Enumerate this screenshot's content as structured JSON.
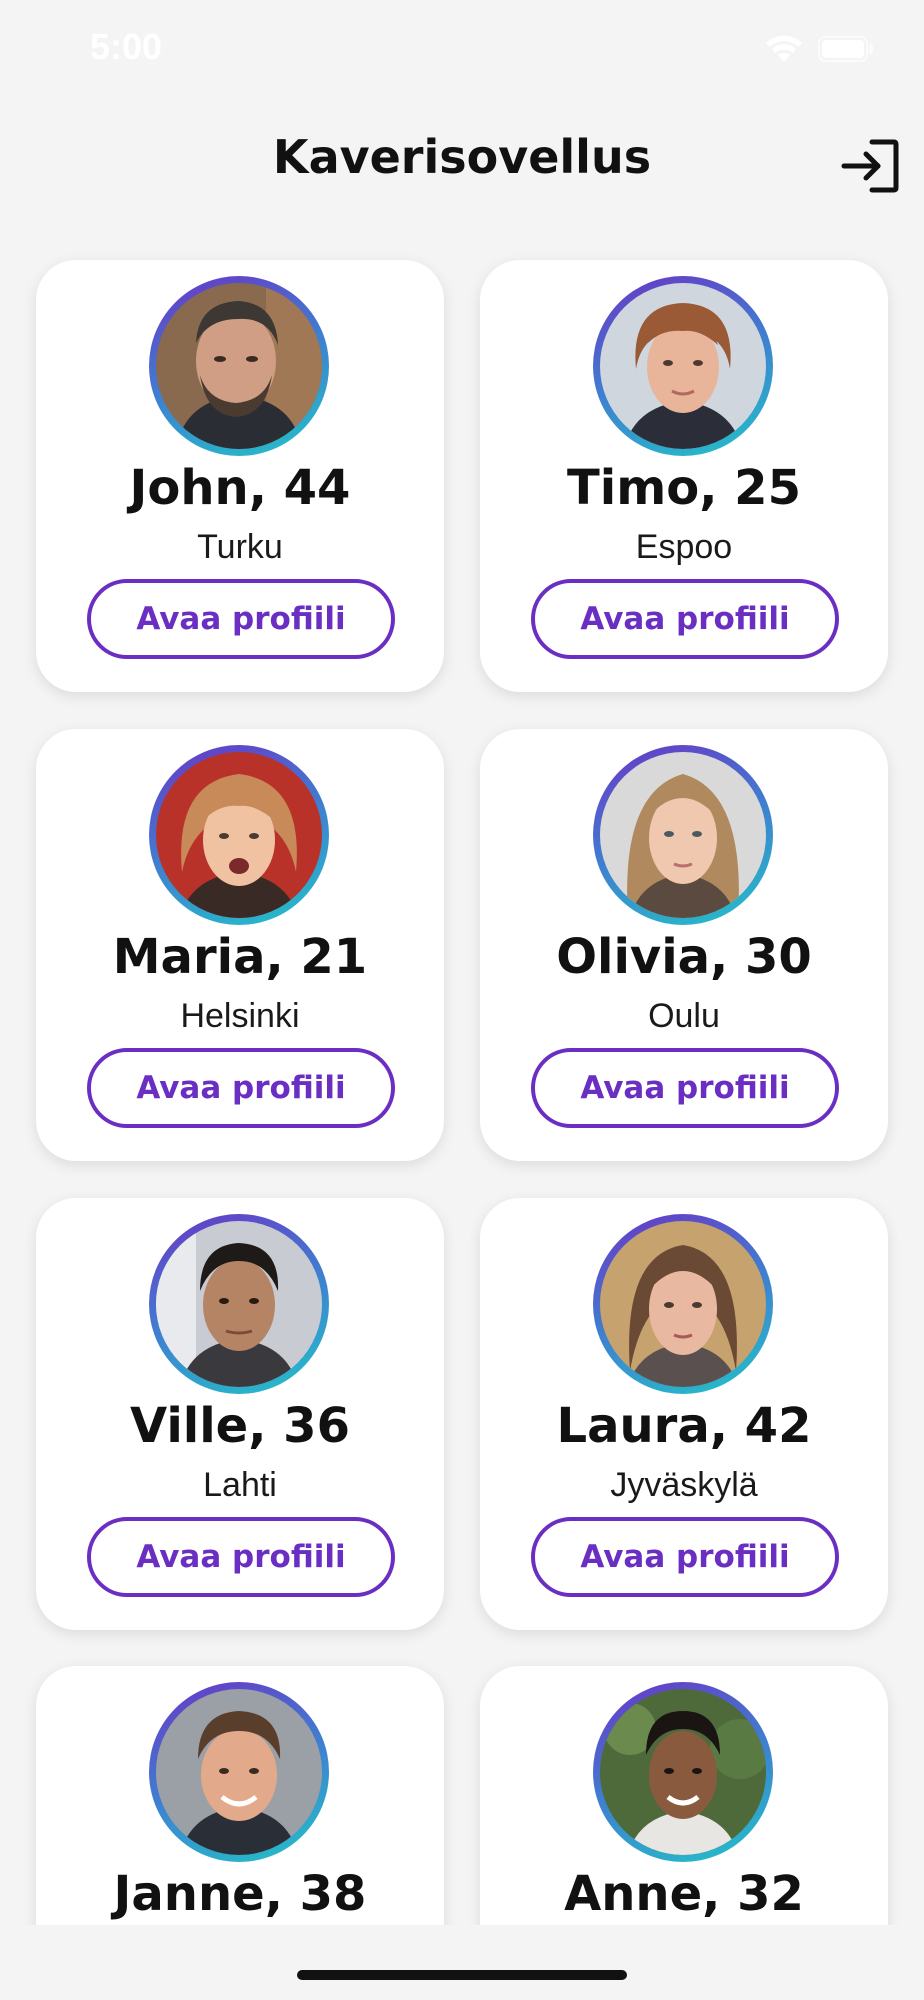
{
  "status_bar": {
    "time": "5:00",
    "wifi_icon": "wifi-icon",
    "battery_icon": "battery-icon"
  },
  "header": {
    "title": "Kaverisovellus",
    "logout_icon": "logout-icon"
  },
  "colors": {
    "accent": "#6a2fc2",
    "ring_start": "#6a35c6",
    "ring_end": "#22c4c8",
    "background": "#f4f4f4",
    "card": "#ffffff"
  },
  "friends": [
    {
      "name": "John, 44",
      "city": "Turku",
      "button": "Avaa profiili"
    },
    {
      "name": "Timo, 25",
      "city": "Espoo",
      "button": "Avaa profiili"
    },
    {
      "name": "Maria, 21",
      "city": "Helsinki",
      "button": "Avaa profiili"
    },
    {
      "name": "Olivia, 30",
      "city": "Oulu",
      "button": "Avaa profiili"
    },
    {
      "name": "Ville, 36",
      "city": "Lahti",
      "button": "Avaa profiili"
    },
    {
      "name": "Laura, 42",
      "city": "Jyväskylä",
      "button": "Avaa profiili"
    },
    {
      "name": "Janne, 38",
      "city": "",
      "button": ""
    },
    {
      "name": "Anne, 32",
      "city": "",
      "button": ""
    }
  ]
}
